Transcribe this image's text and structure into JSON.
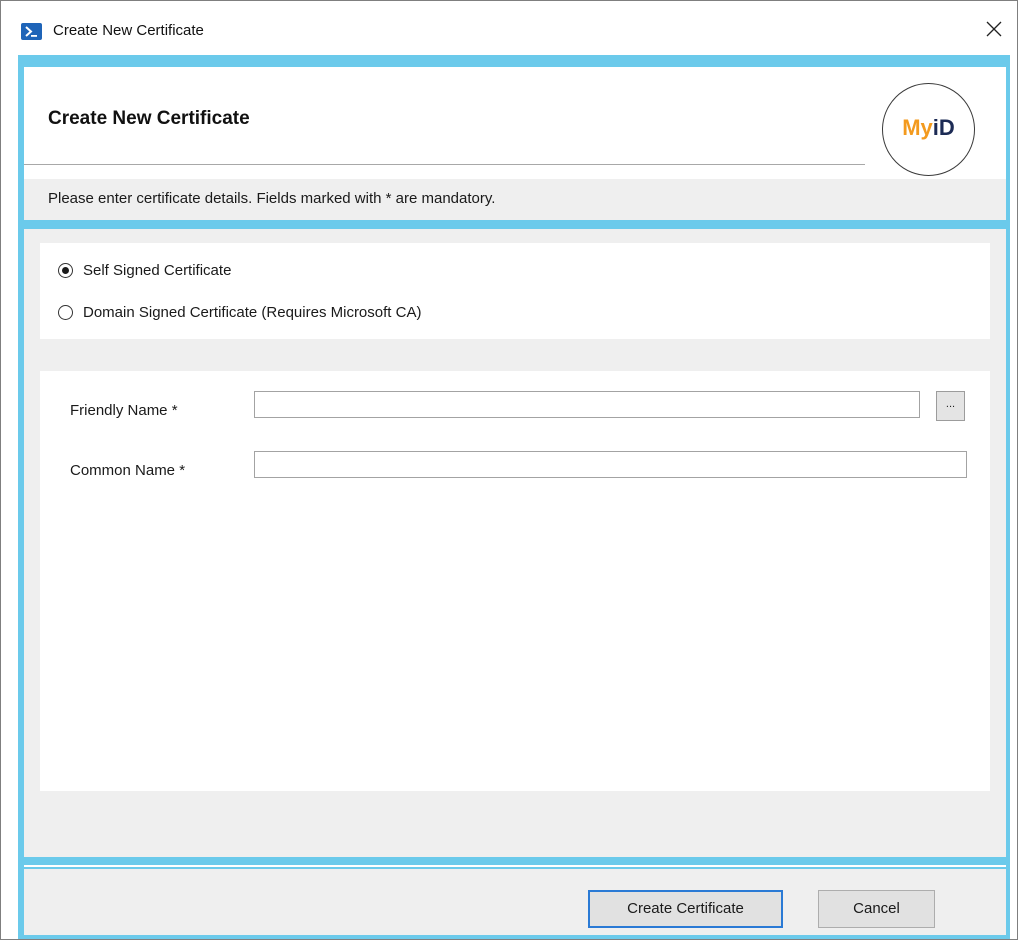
{
  "window": {
    "title": "Create New Certificate",
    "icon": "powershell-icon",
    "close_icon": "close-icon"
  },
  "header": {
    "title": "Create New Certificate",
    "logo_text_a": "My",
    "logo_text_b": "iD",
    "instruction": "Please enter certificate details. Fields marked with * are mandatory."
  },
  "certificate_type": {
    "options": [
      {
        "label": "Self Signed Certificate",
        "selected": true
      },
      {
        "label": "Domain Signed Certificate (Requires Microsoft CA)",
        "selected": false
      }
    ]
  },
  "fields": {
    "friendly_name": {
      "label": "Friendly Name *",
      "value": ""
    },
    "common_name": {
      "label": "Common Name *",
      "value": ""
    },
    "browse_label": "..."
  },
  "footer": {
    "create_label": "Create Certificate",
    "cancel_label": "Cancel"
  },
  "colors": {
    "frame": "#6bcaeb",
    "panel": "#efefef",
    "logo_orange": "#f39a1e",
    "logo_navy": "#1c2b55"
  }
}
